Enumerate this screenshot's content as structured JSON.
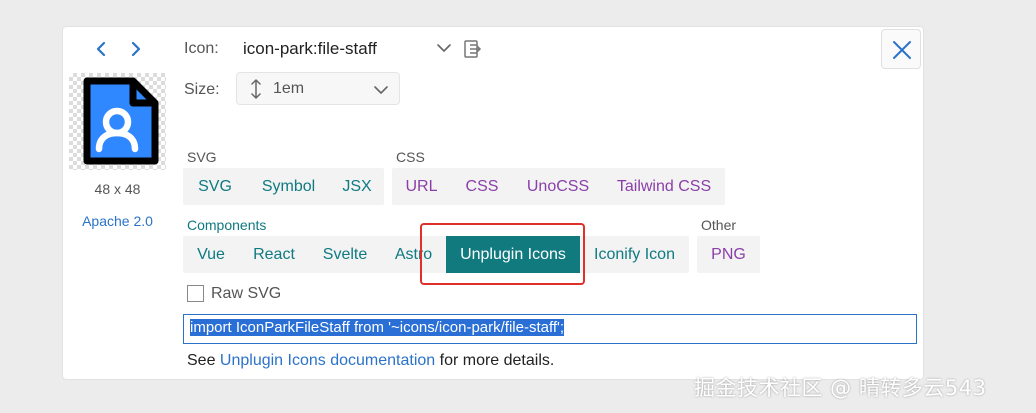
{
  "nav": {
    "prev": "‹",
    "next": "›"
  },
  "preview": {
    "dimensions": "48 x 48",
    "license": "Apache 2.0"
  },
  "icon": {
    "label": "Icon:",
    "name": "icon-park:file-staff"
  },
  "size": {
    "label": "Size:",
    "value": "1em"
  },
  "groups": {
    "svg": {
      "title": "SVG",
      "buttons": [
        "SVG",
        "Symbol",
        "JSX"
      ]
    },
    "css": {
      "title": "CSS",
      "buttons": [
        "URL",
        "CSS",
        "UnoCSS",
        "Tailwind CSS"
      ]
    },
    "components": {
      "title": "Components",
      "buttons": [
        "Vue",
        "React",
        "Svelte",
        "Astro",
        "Unplugin Icons",
        "Iconify Icon"
      ],
      "active": "Unplugin Icons"
    },
    "other": {
      "title": "Other",
      "buttons": [
        "PNG"
      ]
    }
  },
  "raw_svg": {
    "label": "Raw SVG",
    "checked": false
  },
  "code": "import IconParkFileStaff from '~icons/icon-park/file-staff';",
  "doc": {
    "prefix": "See ",
    "link": "Unplugin Icons documentation",
    "suffix": " for more details."
  },
  "watermark": "掘金技术社区 @ 晴转多云543",
  "colors": {
    "teal": "#117a7f",
    "purple": "#8a3fa8",
    "link": "#2b73c9",
    "highlight": "#e0302a",
    "icon_blue": "#2f88ff"
  }
}
